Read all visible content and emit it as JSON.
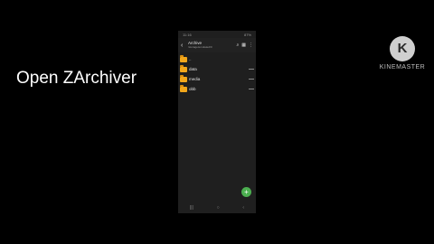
{
  "caption": "Open ZArchiver",
  "watermark": {
    "logo_letter": "K",
    "text": "KINEMASTER"
  },
  "phone": {
    "statusbar": {
      "left": "11:16",
      "right": "87%"
    },
    "appbar": {
      "title": "Archive",
      "subtitle": "/storage/emulated/0"
    },
    "files": [
      {
        "name": ".."
      },
      {
        "name": "data"
      },
      {
        "name": "media"
      },
      {
        "name": "obb"
      }
    ],
    "fab_label": "+",
    "nav": {
      "recent": "|||",
      "home": "○",
      "back": "‹"
    }
  },
  "colors": {
    "background": "#000000",
    "folder": "#f2a71b",
    "fab": "#4caf50"
  }
}
